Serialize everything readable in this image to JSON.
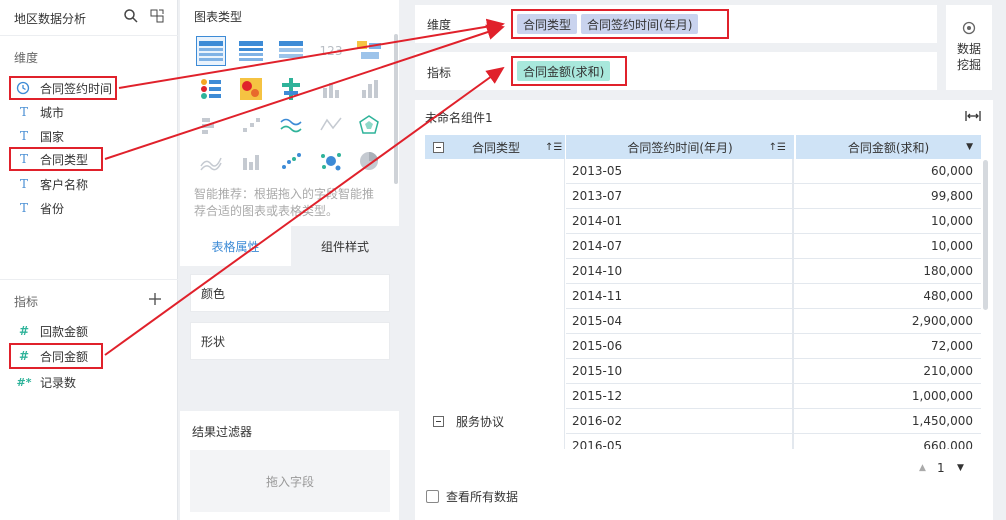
{
  "left": {
    "title": "地区数据分析",
    "dimensions_label": "维度",
    "dimensions": [
      {
        "icon": "clock-icon",
        "label": "合同签约时间"
      },
      {
        "icon": "text-type-icon",
        "label": "城市"
      },
      {
        "icon": "text-type-icon",
        "label": "国家"
      },
      {
        "icon": "text-type-icon",
        "label": "合同类型"
      },
      {
        "icon": "text-type-icon",
        "label": "客户名称"
      },
      {
        "icon": "text-type-icon",
        "label": "省份"
      }
    ],
    "measures_label": "指标",
    "measures": [
      {
        "icon": "number-type-icon",
        "label": "回款金额"
      },
      {
        "icon": "number-type-icon",
        "label": "合同金额"
      },
      {
        "icon": "record-count-icon",
        "label": "记录数"
      }
    ]
  },
  "mid": {
    "chart_type_label": "图表类型",
    "recommend_text_1": "智能推荐：根据拖入的字段智能推",
    "recommend_text_2": "荐合适的图表或表格类型。",
    "tab_table_props": "表格属性",
    "tab_component_style": "组件样式",
    "color_label": "颜色",
    "shape_label": "形状",
    "result_filter_label": "结果过滤器",
    "drop_field_placeholder": "拖入字段"
  },
  "shelf": {
    "dimension_label": "维度",
    "dimension_pills": [
      "合同类型",
      "合同签约时间(年月)"
    ],
    "measure_label": "指标",
    "measure_pills": [
      "合同金额(求和)"
    ],
    "data_mining_label_1": "数据",
    "data_mining_label_2": "挖掘"
  },
  "table": {
    "component_title": "未命名组件1",
    "headers": [
      "合同类型",
      "合同签约时间(年月)",
      "合同金额(求和)"
    ],
    "group_label": "服务协议",
    "rows": [
      {
        "month": "2013-05",
        "amount": "60,000"
      },
      {
        "month": "2013-07",
        "amount": "99,800"
      },
      {
        "month": "2014-01",
        "amount": "10,000"
      },
      {
        "month": "2014-07",
        "amount": "10,000"
      },
      {
        "month": "2014-10",
        "amount": "180,000"
      },
      {
        "month": "2014-11",
        "amount": "480,000"
      },
      {
        "month": "2015-04",
        "amount": "2,900,000"
      },
      {
        "month": "2015-06",
        "amount": "72,000"
      },
      {
        "month": "2015-10",
        "amount": "210,000"
      },
      {
        "month": "2015-12",
        "amount": "1,000,000"
      },
      {
        "month": "2016-02",
        "amount": "1,450,000"
      },
      {
        "month": "2016-05",
        "amount": "660,000"
      }
    ],
    "page_number": "1",
    "view_all_label": "查看所有数据"
  },
  "colors": {
    "accent": "#3d8bd6",
    "highlight": "#e0212b",
    "dim_pill": "#c9d3ee",
    "measure_pill": "#a8e8dc",
    "header": "#cfe3f6"
  }
}
